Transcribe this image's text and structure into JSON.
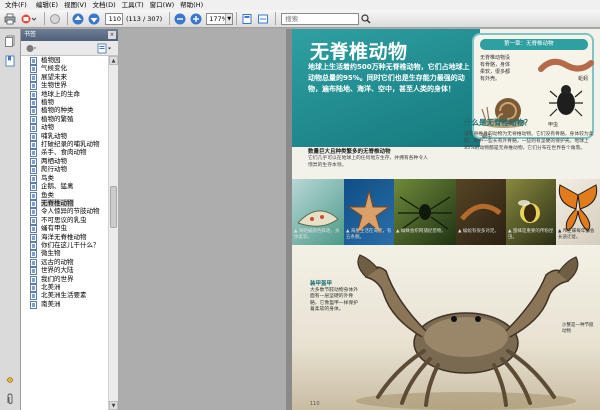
{
  "menu": {
    "file": "文件(F)",
    "edit": "编辑(E)",
    "view": "视图(V)",
    "document": "文档(D)",
    "tools": "工具(T)",
    "window": "窗口(W)",
    "help": "帮助(H)"
  },
  "toolbar": {
    "page_current": "110",
    "page_count": "(113 / 307)",
    "zoom": "177%",
    "search_placeholder": "搜索"
  },
  "bookmarks": {
    "header": "书签",
    "items": [
      {
        "label": "植物园"
      },
      {
        "label": "气候变化"
      },
      {
        "label": "展望未来"
      },
      {
        "label": "生物世界"
      },
      {
        "label": "地球上的生命"
      },
      {
        "label": "植物"
      },
      {
        "label": "植物的种类"
      },
      {
        "label": "植物的繁殖"
      },
      {
        "label": "动物"
      },
      {
        "label": "哺乳动物"
      },
      {
        "label": "打破纪录的哺乳动物"
      },
      {
        "label": "杀手、食肉动物"
      },
      {
        "label": "两栖动物"
      },
      {
        "label": "爬行动物"
      },
      {
        "label": "鸟类"
      },
      {
        "label": "企鹅、猛禽"
      },
      {
        "label": "鱼类"
      },
      {
        "label": "无脊椎动物"
      },
      {
        "label": "令人惊异的节肢动物"
      },
      {
        "label": "不可思议的乳虫"
      },
      {
        "label": "蛹有甲虫"
      },
      {
        "label": "海洋无脊椎动物"
      },
      {
        "label": "你们在这儿干什么？"
      },
      {
        "label": "微生物"
      },
      {
        "label": "远古的动物"
      },
      {
        "label": "世界的大陆"
      },
      {
        "label": "我们的世界"
      },
      {
        "label": "北美洲"
      },
      {
        "label": "北美洲生活要素"
      },
      {
        "label": "南美洲"
      }
    ],
    "selected_index": 17
  },
  "page": {
    "title": "无脊椎动物",
    "intro": "地球上生活着约500万种无脊椎动物，它们占地球上动物总量的95%。同时它们也是生存能力最强的动物，遍布陆地、海洋、空中，甚至人类的身体！",
    "box_head": "第一章：无脊椎动物",
    "box_sub": "无脊椎动物没有骨骼，身体柔软，很多都有外壳。",
    "label_worm": "蚯蚓",
    "label_snail": "蜗牛",
    "label_beetle": "甲虫",
    "whatis_title": "什么是无脊椎动物？",
    "whatis_text": "没有脊椎骨的动物为无脊椎动物。它们没有骨骼，身体较为柔软，其中一些长有外骨骼，一些则有坚硬的保护壳。地球上95%的动物都是无脊椎动物，它们分布在世界各个角落。",
    "photo_head": "数量巨大且种类繁多的无脊椎动物",
    "photo_text": "它们几乎可以在地球上的任何地方生存，并拥有各种令人惊异的生存本领。",
    "cap1": "▲ 海蛞蝓颜色鲜艳，身体柔软。",
    "cap2": "▲ 海星生活在海底，有五条腕。",
    "cap3": "▲ 蜘蛛会织网捕捉猎物。",
    "cap4": "▲ 蜈蚣有很多对足。",
    "cap5": "▲ 蜜蜂是重要的传粉昆虫。",
    "cap6": "▲ 帝王蝶每年都会长途迁徙。",
    "crab_head": "装甲盔甲",
    "crab_text": "大多数节肢动物身体外面有一层坚硬的外骨骼，它像盔甲一样保护着柔软的身体。",
    "crab_side": "沙蟹是一种节肢动物",
    "page_number": "110"
  }
}
